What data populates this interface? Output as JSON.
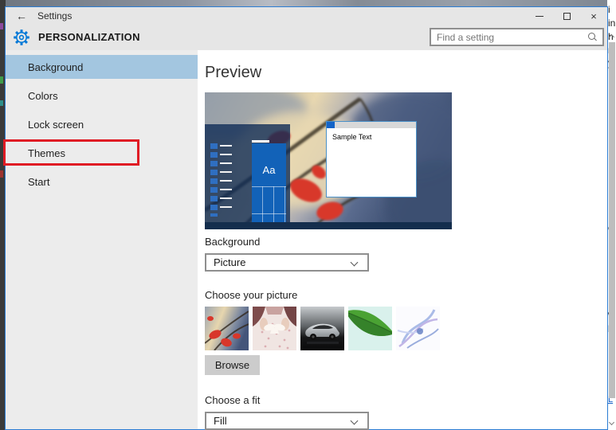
{
  "window": {
    "title": "Settings",
    "glyphs": {
      "back": "←",
      "close": "×"
    }
  },
  "header": {
    "page_title": "PERSONALIZATION",
    "search": {
      "placeholder": "Find a setting",
      "icon": "magnifier"
    }
  },
  "sidebar": {
    "items": [
      {
        "label": "Background",
        "selected": true
      },
      {
        "label": "Colors",
        "selected": false
      },
      {
        "label": "Lock screen",
        "selected": false
      },
      {
        "label": "Themes",
        "selected": false,
        "annotated": true
      },
      {
        "label": "Start",
        "selected": false
      }
    ]
  },
  "main": {
    "preview_title": "Preview",
    "preview": {
      "tile_label": "Aa",
      "sample_window_text": "Sample Text"
    },
    "background_label": "Background",
    "background_select": {
      "value": "Picture"
    },
    "choose_picture_label": "Choose your picture",
    "pictures": [
      {
        "name": "autumn-leaves"
      },
      {
        "name": "floral-dress"
      },
      {
        "name": "silver-car"
      },
      {
        "name": "green-leaf"
      },
      {
        "name": "abstract-blue"
      }
    ],
    "browse_label": "Browse",
    "choose_fit_label": "Choose a fit",
    "fit_select": {
      "value": "Fill"
    }
  },
  "annotation": {
    "shape": "red-rectangle",
    "target": "Themes",
    "color": "#e01b24"
  },
  "colors": {
    "accent": "#0078d7",
    "window_border": "#2b7cd3",
    "selected_item_bg": "#a3c6e0",
    "header_bg": "#e6e6e6",
    "sidebar_bg": "#ececec"
  },
  "background_clutter": {
    "fragments": [
      "i",
      "in",
      "h",
      "nl",
      "yi",
      "e",
      "w",
      "h",
      "L"
    ]
  },
  "icons": {
    "back": "arrow-left",
    "settings": "gear",
    "search": "magnifier",
    "minimize": "dash",
    "maximize": "square",
    "close": "x",
    "dropdown": "chevron-down"
  }
}
